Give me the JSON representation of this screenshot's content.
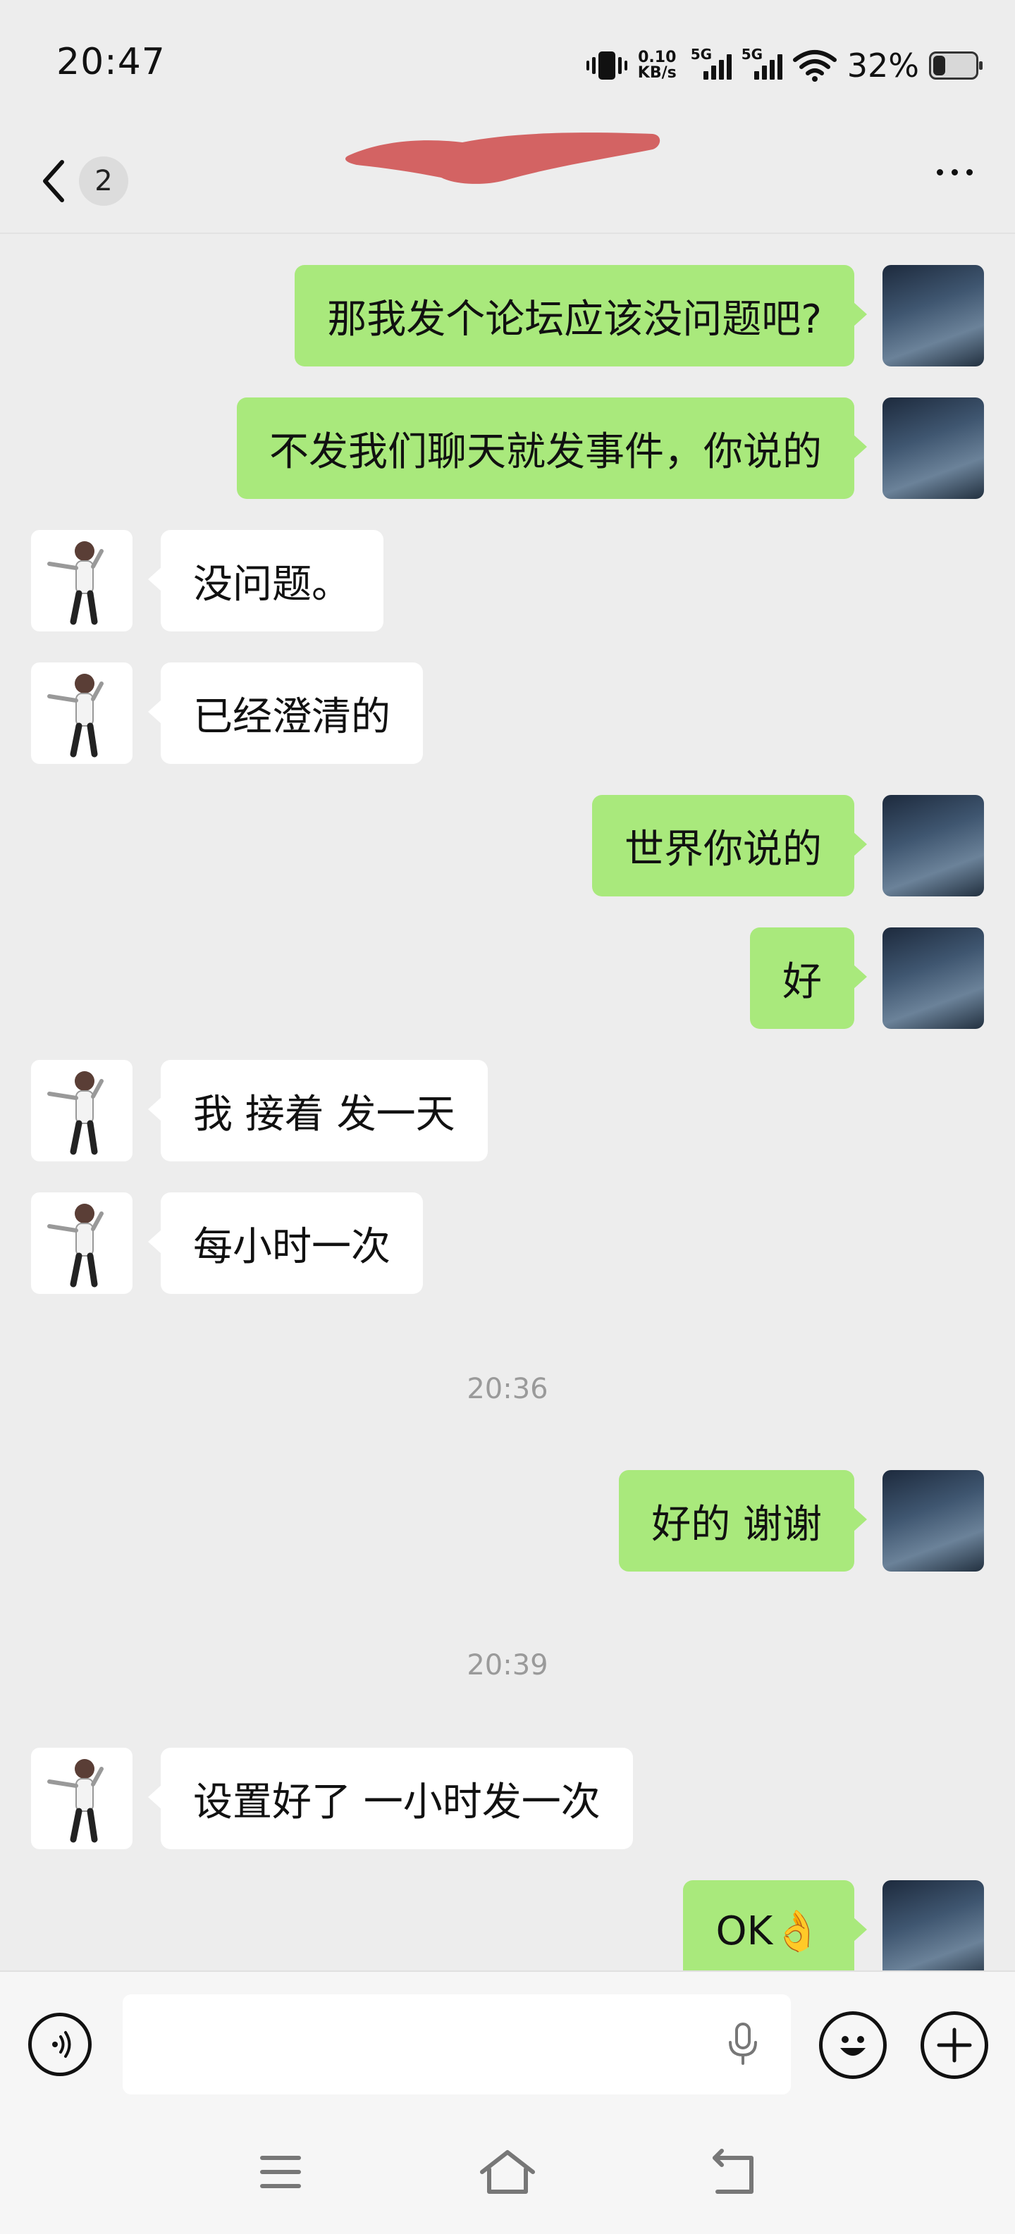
{
  "status_bar": {
    "time": "20:47",
    "net_speed_value": "0.10",
    "net_speed_unit": "KB/s",
    "sim1_label": "5G",
    "sim2_label": "5G",
    "battery_percent": "32%"
  },
  "header": {
    "unread_count": "2",
    "contact_name": ""
  },
  "messages": [
    {
      "side": "me",
      "text": "那我发个论坛应该没问题吧?"
    },
    {
      "side": "me",
      "text": "不发我们聊天就发事件，你说的"
    },
    {
      "side": "them",
      "text": "没问题。"
    },
    {
      "side": "them",
      "text": "已经澄清的"
    },
    {
      "side": "me",
      "text": "世界你说的"
    },
    {
      "side": "me",
      "text": "好"
    },
    {
      "side": "them",
      "text": "我 接着 发一天"
    },
    {
      "side": "them",
      "text": "每小时一次"
    },
    {
      "timestamp": "20:36"
    },
    {
      "side": "me",
      "text": "好的  谢谢"
    },
    {
      "timestamp": "20:39"
    },
    {
      "side": "them",
      "text": "设置好了 一小时发一次"
    },
    {
      "side": "me",
      "text": "OK👌"
    }
  ],
  "input": {
    "value": "",
    "placeholder": ""
  }
}
